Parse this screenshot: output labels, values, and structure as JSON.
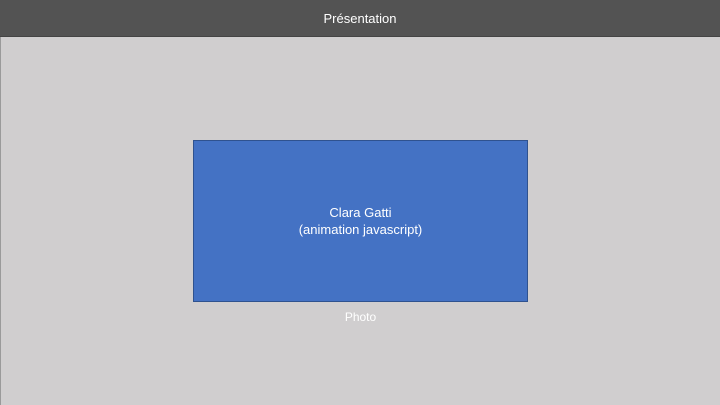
{
  "header": {
    "title": "Présentation"
  },
  "photo": {
    "name": "Clara Gatti",
    "subtitle": "(animation javascript)",
    "caption": "Photo"
  },
  "colors": {
    "background": "#d0cecf",
    "header": "#535353",
    "photo_fill": "#4472c4",
    "photo_border": "#2f528f",
    "text": "#ffffff"
  }
}
